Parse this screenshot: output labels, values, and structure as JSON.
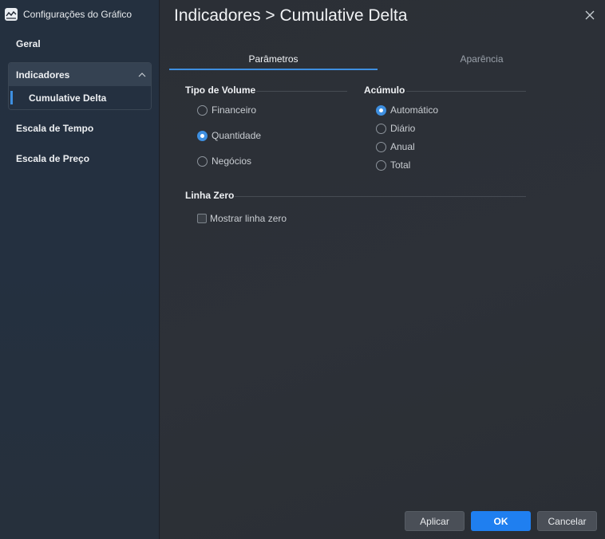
{
  "window": {
    "title": "Configurações do Gráfico"
  },
  "sidebar": {
    "items": [
      {
        "label": "Geral"
      },
      {
        "label": "Indicadores",
        "children": [
          {
            "label": "Cumulative Delta"
          }
        ]
      },
      {
        "label": "Escala de Tempo"
      },
      {
        "label": "Escala de Preço"
      }
    ]
  },
  "header": {
    "title": "Indicadores > Cumulative Delta"
  },
  "tabs": [
    {
      "label": "Parâmetros",
      "active": true
    },
    {
      "label": "Aparência",
      "active": false
    }
  ],
  "volume_type": {
    "title": "Tipo de Volume",
    "options": [
      {
        "label": "Financeiro",
        "checked": false
      },
      {
        "label": "Quantidade",
        "checked": true
      },
      {
        "label": "Negócios",
        "checked": false
      }
    ]
  },
  "accumulation": {
    "title": "Acúmulo",
    "options": [
      {
        "label": "Automático",
        "checked": true
      },
      {
        "label": "Diário",
        "checked": false
      },
      {
        "label": "Anual",
        "checked": false
      },
      {
        "label": "Total",
        "checked": false
      }
    ]
  },
  "zero_line": {
    "title": "Linha Zero",
    "checkbox_label": "Mostrar linha zero",
    "checked": false
  },
  "footer": {
    "apply_label": "Aplicar",
    "ok_label": "OK",
    "cancel_label": "Cancelar"
  },
  "colors": {
    "accent": "#3e8fe0",
    "primary_button": "#1f7ff0"
  },
  "icons": {
    "app": "chart-line-icon",
    "close": "close-icon",
    "collapse": "chevron-up-icon"
  }
}
